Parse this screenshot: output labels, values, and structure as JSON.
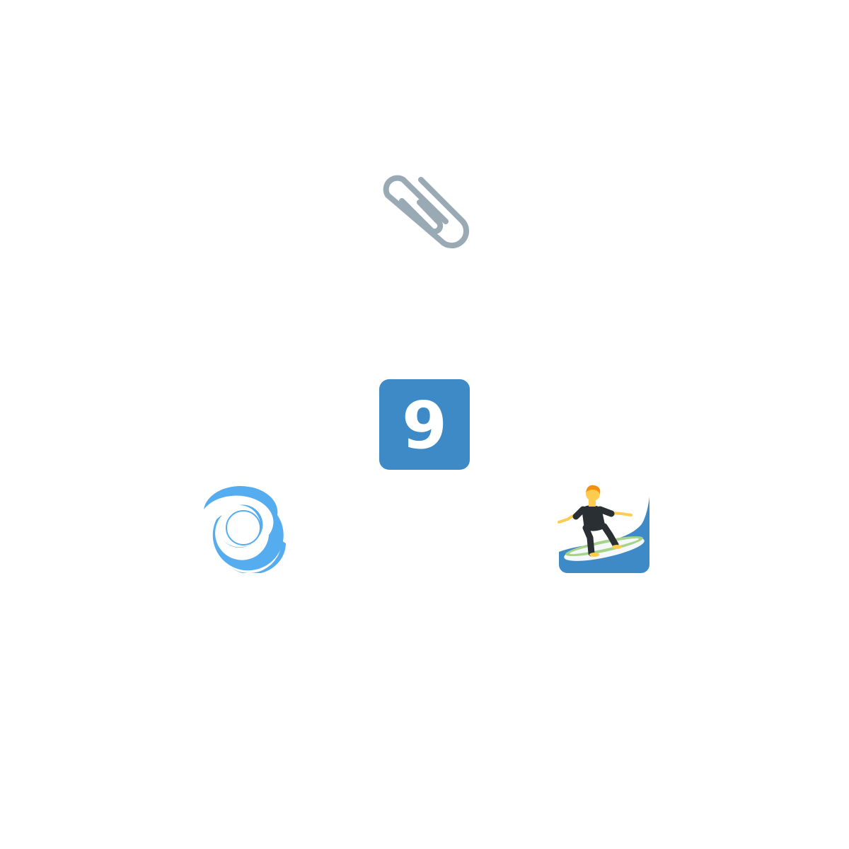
{
  "keycap": {
    "digit": "9",
    "color": "#3E8AC6"
  },
  "icons": [
    {
      "name": "paperclip-icon",
      "color": "#9AAAB4"
    },
    {
      "name": "keycap-9-icon",
      "color": "#3E8AC6"
    },
    {
      "name": "cyclone-icon",
      "color": "#55ACEE"
    },
    {
      "name": "person-surfing-icon",
      "color": "#3E8AC6"
    }
  ]
}
